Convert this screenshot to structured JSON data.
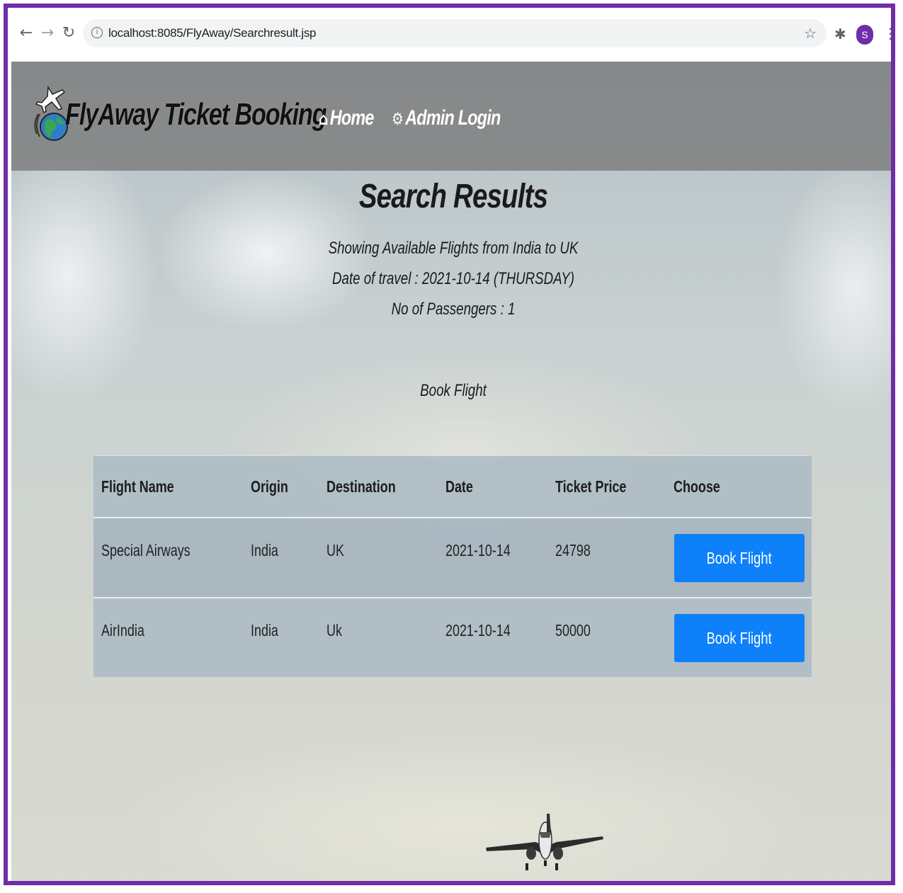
{
  "browser": {
    "url": "localhost:8085/FlyAway/Searchresult.jsp",
    "profile_initial": "S",
    "icons": [
      "back-icon",
      "forward-icon",
      "reload-icon",
      "info-icon",
      "star-icon",
      "extensions-icon",
      "menu-icon"
    ]
  },
  "navbar": {
    "brand": "FlyAway Ticket Booking",
    "home_label": "Home",
    "admin_label": "Admin Login"
  },
  "main": {
    "title": "Search Results",
    "route_line": "Showing Available Flights from India to UK",
    "date_line": "Date of travel : 2021-10-14 (THURSDAY)",
    "passengers_line": "No of Passengers : 1",
    "book_heading": "Book Flight"
  },
  "table": {
    "headers": [
      "Flight Name",
      "Origin",
      "Destination",
      "Date",
      "Ticket Price",
      "Choose"
    ],
    "rows": [
      {
        "flight": "Special Airways",
        "origin": "India",
        "destination": "UK",
        "date": "2021-10-14",
        "price": "24798",
        "action": "Book Flight"
      },
      {
        "flight": "AirIndia",
        "origin": "India",
        "destination": "Uk",
        "date": "2021-10-14",
        "price": "50000",
        "action": "Book Flight"
      }
    ]
  },
  "colors": {
    "frame": "#6f2da8",
    "button": "#0d80fa",
    "navbar": "#787878"
  }
}
